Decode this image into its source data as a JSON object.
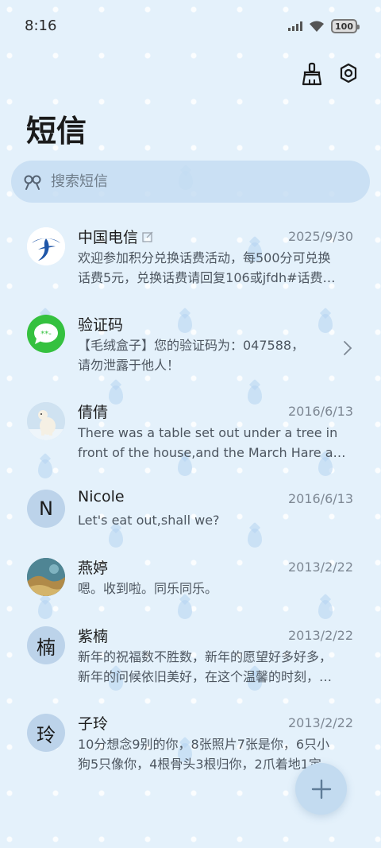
{
  "status": {
    "time": "8:16",
    "battery": "100"
  },
  "header": {
    "title": "短信",
    "clean_icon": "broom-icon",
    "settings_icon": "gear-icon"
  },
  "search": {
    "placeholder": "搜索短信",
    "icon": "search-icon"
  },
  "messages": [
    {
      "sender": "中国电信",
      "date": "2025/9/30",
      "line1": "欢迎参加积分兑换话费活动，每500分可兑换",
      "line2": "话费5元，兑换话费请回复106或jfdh#话费…",
      "avatar": "china-telecom-logo",
      "edit_icon": "edit-icon"
    },
    {
      "sender": "验证码",
      "date": "",
      "line1": "【毛绒盒子】您的验证码为：047588，",
      "line2": "请勿泄露于他人！",
      "avatar": "message-app-icon"
    },
    {
      "sender": "倩倩",
      "date": "2016/6/13",
      "line1": "There was a table set out under a tree in",
      "line2": "front of the house,and the March Hare an…",
      "avatar": "polar-bear-photo"
    },
    {
      "sender": "Nicole",
      "date": "2016/6/13",
      "line1": "Let's eat out,shall we?",
      "line2": "",
      "avatar_letter": "N"
    },
    {
      "sender": "燕婷",
      "date": "2013/2/22",
      "line1": "嗯。收到啦。同乐同乐。",
      "line2": "",
      "avatar": "landscape-photo"
    },
    {
      "sender": "紫楠",
      "date": "2013/2/22",
      "line1": "新年的祝福数不胜数，新年的愿望好多好多，",
      "line2": "新年的问候依旧美好，在这个温馨的时刻，…",
      "avatar_letter": "楠"
    },
    {
      "sender": "子玲",
      "date": "2013/2/22",
      "line1": "10分想念9别的你，8张照片7张是你，6只小",
      "line2": "狗5只像你，4根骨头3根归你，2爪着地1定…",
      "avatar_letter": "玲"
    }
  ],
  "fab": {
    "icon": "plus-icon"
  },
  "colors": {
    "background": "#e4f1fb",
    "accent": "#c3dbf0",
    "telecom_blue": "#1f56a8",
    "message_green": "#35c13f"
  }
}
